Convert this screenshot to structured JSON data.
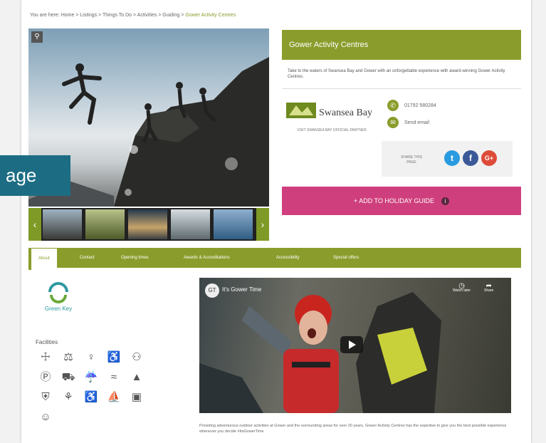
{
  "breadcrumb": {
    "prefix": "You are here: Home > Listings > Things To Do > Activities > Guiding > ",
    "current": "Gower Activity Centres"
  },
  "gallery": {
    "zoom_icon": "magnifier-icon",
    "prev_label": "‹",
    "next_label": "›"
  },
  "listing": {
    "title": "Gower Activity Centres",
    "description": "Take to the waters of Swansea Bay and Gower with an unforgettable experience with award-winning Gower Activity Centres.",
    "partner_logo_text": "Swansea Bay",
    "partner_caption": "VISIT SWANSEA BAY OFFICIAL PARTNER",
    "phone": "01792 580284",
    "email_label": "Send email",
    "share_label": "SHARE THIS PAGE",
    "add_button": "+ ADD TO HOLIDAY GUIDE",
    "info_icon": "i"
  },
  "tabs": [
    "About",
    "Contact",
    "Opening times",
    "Awards & Accreditations",
    "Accessibility",
    "Special offers"
  ],
  "sidebar": {
    "green_logo_text": "Green Key",
    "facilities_title": "Facilities",
    "facility_icons": [
      "family-icon",
      "baby-change-icon",
      "restroom-icon",
      "wheelchair-icon",
      "family-group-icon",
      "parking-icon",
      "car-icon",
      "shower-icon",
      "wifi-icon",
      "campsite-icon",
      "picnic-icon",
      "outdoor-icon",
      "accessible-icon",
      "boating-icon",
      "bin-icon",
      "group-icon"
    ]
  },
  "video": {
    "channel_initials": "GT",
    "title": "It's Gower Time",
    "watch_later": "Watch later",
    "share": "Share"
  },
  "caption": "Providing adventurous outdoor activities at Gower and the surrounding areas for over 20 years, Gower Activity Centres has the expertise to give you the best possible experience whenever you decide #ItsGowerTime",
  "overlay_text": "age",
  "colors": {
    "accent_green": "#8a9d2c",
    "pink": "#cf3f7d",
    "twitter": "#2a9be0",
    "facebook": "#3b5998",
    "google": "#dd4b39",
    "overlay_teal": "#1c6d83"
  }
}
